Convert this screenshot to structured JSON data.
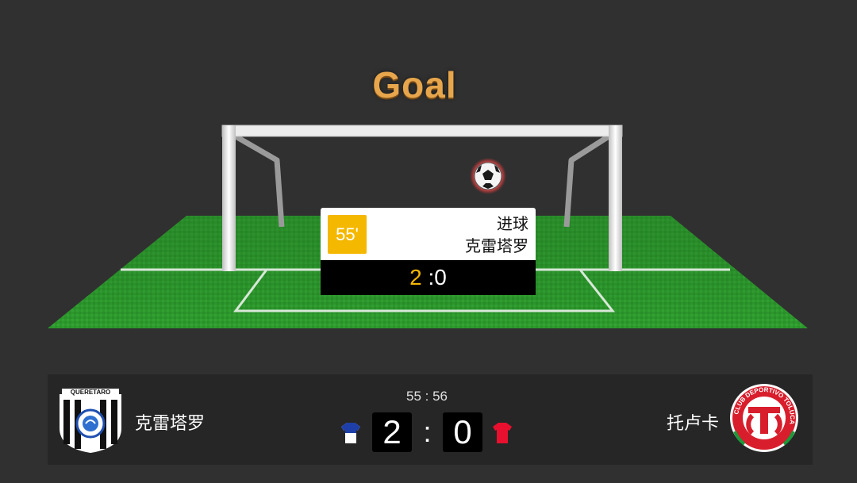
{
  "scene": {
    "title": "Goal"
  },
  "event": {
    "minute": "55'",
    "type": "进球",
    "team": "克雷塔罗",
    "home_score": "2",
    "away_score": ":0"
  },
  "scoreboard": {
    "clock": "55 : 56",
    "home": {
      "name": "克雷塔罗",
      "score": "2",
      "logo_text": "QUERETARO",
      "shirt_color": "#1e3fa8"
    },
    "separator": ":",
    "away": {
      "name": "托卢卡",
      "score": "0",
      "logo_text": "CLUB DEPORTIVO TOLUCA",
      "shirt_color": "#e8102e"
    }
  },
  "colors": {
    "background": "#303030",
    "pitch": "#2d9a2d",
    "accent": "#f5b800",
    "title": "#e7a64c"
  },
  "icons": {
    "ball": "soccer-ball-icon",
    "home_shirt": "shirt-icon",
    "away_shirt": "shirt-icon"
  }
}
